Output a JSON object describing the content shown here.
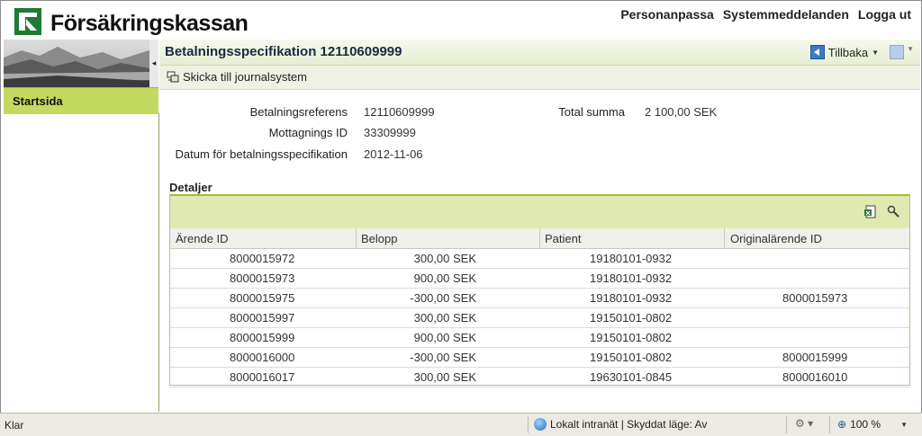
{
  "header": {
    "brand": "Försäkringskassan",
    "links": [
      "Personanpassa",
      "Systemmeddelanden",
      "Logga ut"
    ]
  },
  "sidebar": {
    "collapse_glyph": "◂",
    "heading": "Startsida"
  },
  "main": {
    "title": "Betalningsspecifikation 12110609999",
    "back_label": "Tillbaka",
    "send_label": "Skicka till journalsystem"
  },
  "info": {
    "ref_label": "Betalningsreferens",
    "ref_value": "12110609999",
    "receipt_label": "Mottagnings ID",
    "receipt_value": "33309999",
    "date_label": "Datum för betalningsspecifikation",
    "date_value": "2012-11-06",
    "total_label": "Total summa",
    "total_value": "2 100,00 SEK"
  },
  "details": {
    "title": "Detaljer",
    "columns": [
      "Ärende ID",
      "Belopp",
      "Patient",
      "Originalärende ID"
    ],
    "rows": [
      [
        "8000015972",
        "300,00 SEK",
        "19180101-0932",
        ""
      ],
      [
        "8000015973",
        "900,00 SEK",
        "19180101-0932",
        ""
      ],
      [
        "8000015975",
        "-300,00 SEK",
        "19180101-0932",
        "8000015973"
      ],
      [
        "8000015997",
        "300,00 SEK",
        "19150101-0802",
        ""
      ],
      [
        "8000015999",
        "900,00 SEK",
        "19150101-0802",
        ""
      ],
      [
        "8000016000",
        "-300,00 SEK",
        "19150101-0802",
        "8000015999"
      ],
      [
        "8000016017",
        "300,00 SEK",
        "19630101-0845",
        "8000016010"
      ]
    ]
  },
  "statusbar": {
    "left": "Klar",
    "zone": "Lokalt intranät | Skyddat läge: Av",
    "zoom": "100 %"
  },
  "icons": [
    "logo-icon",
    "back-icon",
    "forward-icon",
    "send-icon",
    "export-icon",
    "settings-icon",
    "globe-icon",
    "zoom-icon",
    "security-icon"
  ],
  "colors": {
    "accent_green": "#c4d95f",
    "logo_green": "#1f7a32",
    "title_blue": "#1a2a44"
  }
}
